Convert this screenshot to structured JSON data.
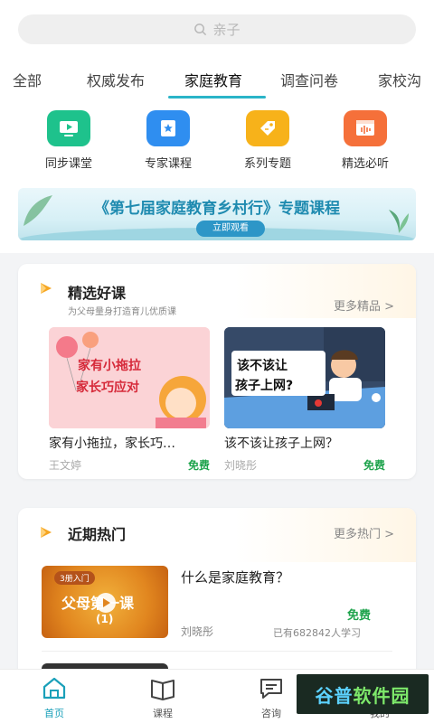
{
  "search": {
    "placeholder": "亲子"
  },
  "tabs": [
    {
      "label": "全部"
    },
    {
      "label": "权威发布"
    },
    {
      "label": "家庭教育",
      "active": true
    },
    {
      "label": "调查问卷"
    },
    {
      "label": "家校沟"
    }
  ],
  "quick_links": [
    {
      "label": "同步课堂",
      "icon": "video-icon",
      "color": "#1ec28c"
    },
    {
      "label": "专家课程",
      "icon": "star-book-icon",
      "color": "#2f8ef0"
    },
    {
      "label": "系列专题",
      "icon": "tag-icon",
      "color": "#f7b21a"
    },
    {
      "label": "精选必听",
      "icon": "audio-icon",
      "color": "#f5703a"
    }
  ],
  "banner": {
    "title": "《第七届家庭教育乡村行》专题课程",
    "button": "立即观看"
  },
  "featured": {
    "title": "精选好课",
    "subtitle": "为父母量身打造育儿优质课",
    "more": "更多精品 >",
    "courses": [
      {
        "title": "家有小拖拉，家长巧…",
        "author": "王文婷",
        "price": "免费",
        "thumb_line1": "家有小拖拉",
        "thumb_line2": "家长巧应对"
      },
      {
        "title": "该不该让孩子上网？",
        "author": "刘晓彤",
        "price": "免费",
        "thumb_line1": "该不该让",
        "thumb_line2": "孩子上网?"
      }
    ]
  },
  "hot": {
    "title": "近期热门",
    "more": "更多热门 >",
    "items": [
      {
        "title": "什么是家庭教育？",
        "author": "刘晓彤",
        "price": "免费",
        "learners": "已有682842人学习",
        "thumb_tag": "3册入门",
        "thumb_title": "父母第一课",
        "thumb_num": "(1)"
      }
    ]
  },
  "bottom_nav": [
    {
      "label": "首页",
      "icon": "home-icon",
      "active": true
    },
    {
      "label": "课程",
      "icon": "book-icon"
    },
    {
      "label": "咨询",
      "icon": "chat-icon"
    },
    {
      "label": "我的",
      "icon": "user-icon"
    }
  ],
  "watermark": {
    "part1": "谷普",
    "part2": "软件园"
  },
  "colors": {
    "accent": "#2ab4c8",
    "free": "#1ea34c",
    "banner_text": "#1f8bb0"
  }
}
